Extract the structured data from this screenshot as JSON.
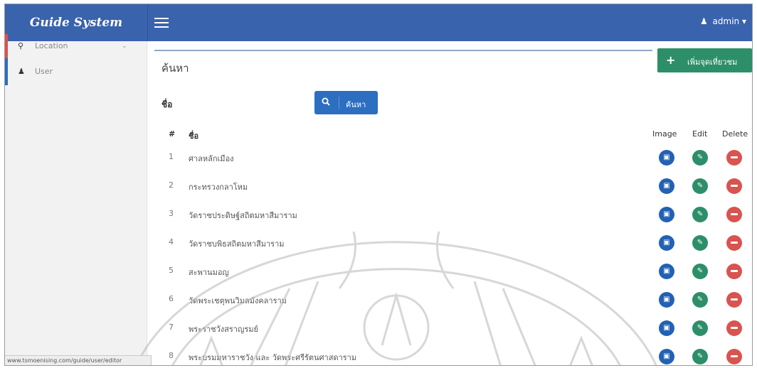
{
  "header": {
    "brand": "Guide System",
    "user": "admin"
  },
  "sidebar": {
    "items": [
      {
        "label": "Location",
        "accent": "#d9534f",
        "icon": "map-marker-icon"
      },
      {
        "label": "User",
        "accent": "#2c6ec0",
        "icon": "user-icon"
      }
    ]
  },
  "main": {
    "title": "ค้นหา",
    "add_button": "เพิ่มจุดเที่ยวชม",
    "search_label": "ชื่อ",
    "search_button": "ค้นหา"
  },
  "table": {
    "headers": {
      "num": "#",
      "name": "ชื่อ",
      "image": "Image",
      "edit": "Edit",
      "delete": "Delete"
    },
    "rows": [
      {
        "num": "1",
        "name": "ศาลหลักเมือง"
      },
      {
        "num": "2",
        "name": "กระทรวงกลาโหม"
      },
      {
        "num": "3",
        "name": "วัดราชประดิษฐ์สถิตมหาสีมาราม"
      },
      {
        "num": "4",
        "name": "วัดราชบพิธสถิตมหาสีมาราม"
      },
      {
        "num": "5",
        "name": "สะพานมอญ"
      },
      {
        "num": "6",
        "name": "วัดพระเชตุพนวิมลมังคลาราม"
      },
      {
        "num": "7",
        "name": "พระราชวังสราญรมย์"
      },
      {
        "num": "8",
        "name": "พระบรมมหาราชวัง และ วัดพระศรีรัตนศาสดาราม"
      }
    ]
  },
  "status_bar": {
    "url": "www.tsmoenising.com/guide/user/editor"
  },
  "colors": {
    "topbar": "#3a63ad",
    "add_button": "#2d8f6a",
    "search_button": "#2c6ec0",
    "image_button": "#2261b4",
    "edit_button": "#2d8f6a",
    "delete_button": "#d9534f"
  }
}
